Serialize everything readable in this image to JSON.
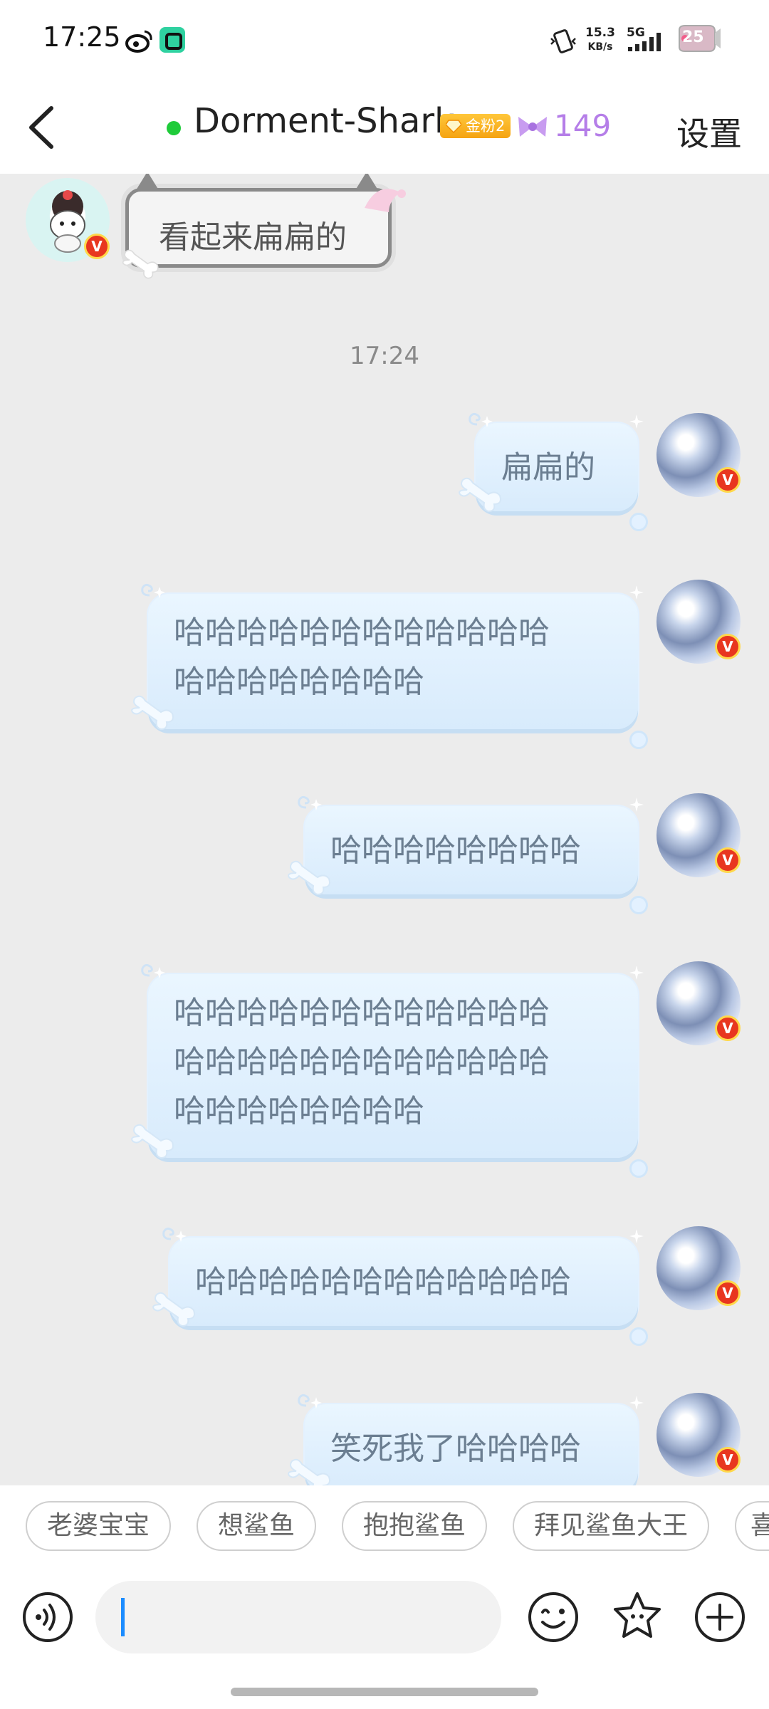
{
  "status_bar": {
    "time": "17:25",
    "net_speed_value": "15.3",
    "net_speed_unit": "KB/s",
    "network_type": "5G",
    "battery_level": "25"
  },
  "header": {
    "contact_name": "Dorment-Shark",
    "fan_badge": "金粉2",
    "friend_count": "149",
    "settings_label": "设置"
  },
  "chat": {
    "incoming_message": "看起来扁扁的",
    "time_divider": "17:24",
    "messages": [
      {
        "lines": [
          "扁扁的"
        ]
      },
      {
        "lines": [
          "哈哈哈哈哈哈哈哈哈哈哈哈",
          "哈哈哈哈哈哈哈哈"
        ]
      },
      {
        "lines": [
          "哈哈哈哈哈哈哈哈"
        ]
      },
      {
        "lines": [
          "哈哈哈哈哈哈哈哈哈哈哈哈",
          "哈哈哈哈哈哈哈哈哈哈哈哈",
          "哈哈哈哈哈哈哈哈"
        ]
      },
      {
        "lines": [
          "哈哈哈哈哈哈哈哈哈哈哈哈"
        ]
      },
      {
        "lines": [
          "笑死我了哈哈哈哈"
        ]
      }
    ],
    "vip_badge": "V"
  },
  "quick_replies": [
    "老婆宝宝",
    "想鲨鱼",
    "抱抱鲨鱼",
    "拜见鲨鱼大王",
    "喜"
  ],
  "input_bar": {
    "voice_icon": "voice-icon",
    "emoji_icon": "smile-icon",
    "sticker_icon": "star-face-icon",
    "more_icon": "plus-icon"
  },
  "colors": {
    "accent_green": "#1fcb3a",
    "fan_badge": "#f5a312",
    "friend_count": "#b57ee8",
    "bubble_text": "#6b7e91",
    "chat_background": "#ececec"
  }
}
